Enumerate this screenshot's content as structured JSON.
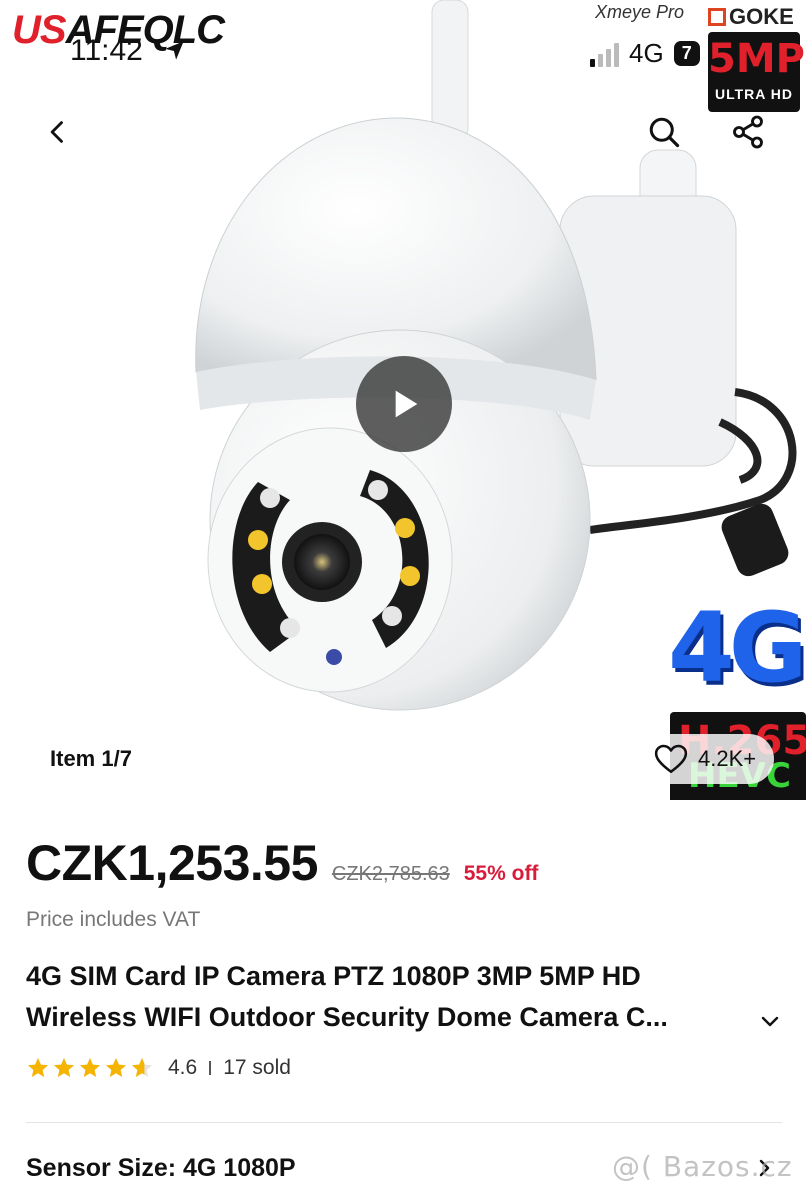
{
  "status": {
    "time": "11:42",
    "network": "4G",
    "battery": "7"
  },
  "hero": {
    "brand_logo_red": "US",
    "brand_logo_rest": "AFEQLC",
    "badge_top_left_text": "Xmeye Pro",
    "badge_goke": "GOKE",
    "badge_mp": "5MP",
    "badge_ultra_hd": "ULTRA HD",
    "badge_4g": "4G",
    "badge_h265": "H.265",
    "badge_hevc": "HEVC",
    "item_counter": "Item 1/7",
    "wishlist_count": "4.2K+"
  },
  "product": {
    "price_now": "CZK1,253.55",
    "price_old": "CZK2,785.63",
    "discount": "55% off",
    "vat_note": "Price includes VAT",
    "title_line_1": "4G SIM Card IP Camera PTZ 1080P 3MP 5MP HD",
    "title_line_2": "Wireless WIFI Outdoor Security Dome Camera C...",
    "rating_value": "4.6",
    "rating_fraction": 0.92,
    "sold": "17 sold",
    "spec_label": "Sensor Size: 4G 1080P"
  },
  "watermark": "@( Bazos.cz",
  "colors": {
    "accent_red": "#d71c3c",
    "star_yellow": "#f5b400",
    "badge_blue": "#1e63e9"
  },
  "icons": {
    "back": "chevron-left-icon",
    "search": "search-icon",
    "share": "share-icon",
    "play": "play-icon",
    "wishlist": "heart-icon",
    "expand": "chevron-down-icon",
    "spec_more": "chevron-right-icon",
    "star": "star-icon"
  }
}
